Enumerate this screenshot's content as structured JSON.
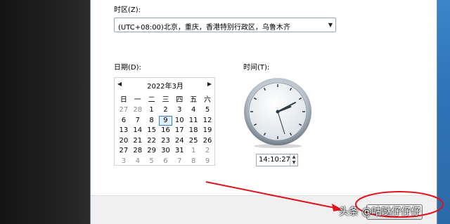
{
  "timezone": {
    "label": "时区(Z):",
    "selected": "(UTC+08:00)北京，重庆，香港特别行政区，乌鲁木齐"
  },
  "date": {
    "label": "日期(D):",
    "month_title": "2022年3月",
    "weekdays": [
      "日",
      "一",
      "二",
      "三",
      "四",
      "五",
      "六"
    ],
    "weeks": [
      [
        "27",
        "28",
        "1",
        "2",
        "3",
        "4",
        "5"
      ],
      [
        "6",
        "7",
        "8",
        "9",
        "10",
        "11",
        "12"
      ],
      [
        "13",
        "14",
        "15",
        "16",
        "17",
        "18",
        "19"
      ],
      [
        "20",
        "21",
        "22",
        "23",
        "24",
        "25",
        "26"
      ],
      [
        "27",
        "28",
        "29",
        "30",
        "31",
        "1",
        "2"
      ],
      [
        "3",
        "4",
        "5",
        "6",
        "7",
        "8",
        "9"
      ]
    ],
    "selected_day": "9"
  },
  "time": {
    "label": "时间(T):",
    "value": "14:10:27"
  },
  "watermark": "头条 @咕哒仔仔仔",
  "icons": {
    "prev": "chevron-left-icon",
    "next": "chevron-right-icon",
    "dropdown": "chevron-down-icon"
  },
  "colors": {
    "selected_day_border": "#3a7cc2",
    "annotation": "#e0141e"
  }
}
